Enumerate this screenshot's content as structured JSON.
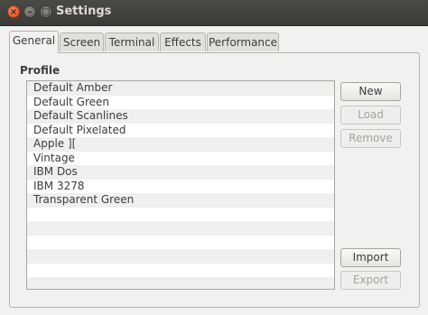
{
  "window": {
    "title": "Settings",
    "close_glyph": "×",
    "minimize_glyph": "–",
    "maximize_glyph": "□"
  },
  "tabs": [
    {
      "label": "General",
      "active": true
    },
    {
      "label": "Screen",
      "active": false
    },
    {
      "label": "Terminal",
      "active": false
    },
    {
      "label": "Effects",
      "active": false
    },
    {
      "label": "Performance",
      "active": false
    }
  ],
  "profile": {
    "title": "Profile",
    "items": [
      "Default Amber",
      "Default Green",
      "Default Scanlines",
      "Default Pixelated",
      "Apple ][",
      "Vintage",
      "IBM Dos",
      "IBM 3278",
      "Transparent Green"
    ]
  },
  "buttons": {
    "new": "New",
    "load": "Load",
    "remove": "Remove",
    "import": "Import",
    "export": "Export"
  },
  "colors": {
    "close_button": "#de4a16",
    "titlebar": "#3a3a37",
    "window_bg": "#f2f1f0"
  }
}
